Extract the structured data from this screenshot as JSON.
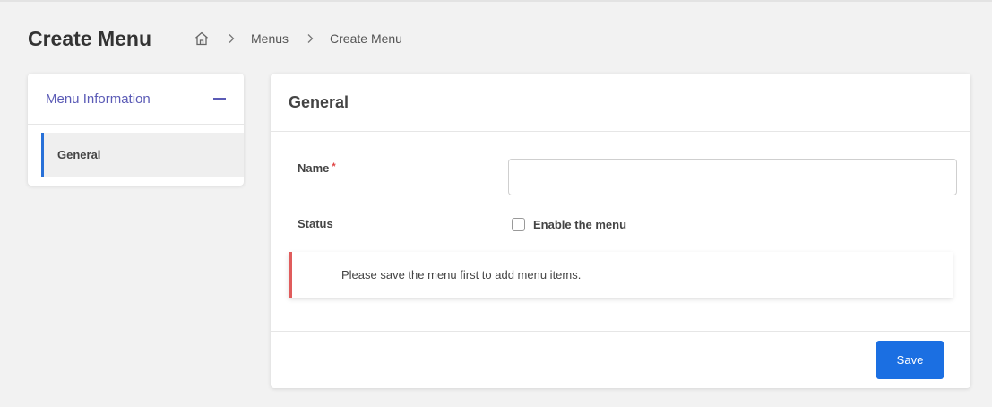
{
  "header": {
    "title": "Create Menu",
    "breadcrumb": [
      "Menus",
      "Create Menu"
    ]
  },
  "sidebar": {
    "title": "Menu Information",
    "items": [
      {
        "label": "General",
        "active": true
      }
    ]
  },
  "form": {
    "section_title": "General",
    "name_label": "Name",
    "required_mark": "*",
    "name_value": "",
    "status_label": "Status",
    "enable_label": "Enable the menu",
    "enable_checked": false,
    "notice": "Please save the menu first to add menu items.",
    "save_label": "Save"
  },
  "colors": {
    "accent": "#5b5bb6",
    "active_border": "#2770d8",
    "primary_button": "#1b6fe2",
    "notice_border": "#e05c5c",
    "required": "#e04646"
  },
  "icons": {
    "home": "home-icon",
    "separator": "chevron-right-icon",
    "collapse": "minus-icon"
  }
}
